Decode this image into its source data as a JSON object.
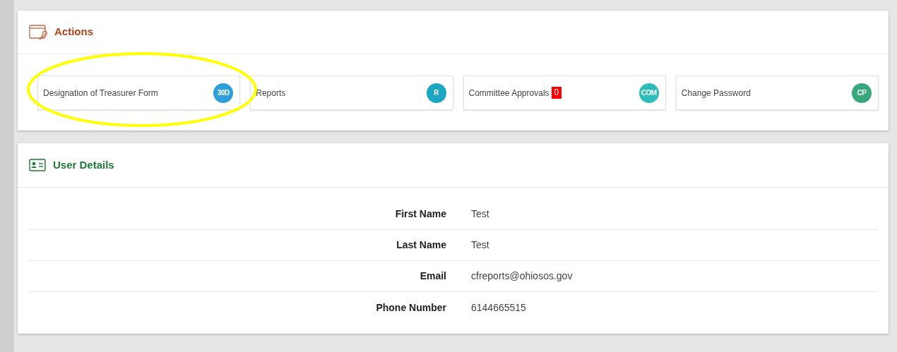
{
  "actions": {
    "title": "Actions",
    "tiles": [
      {
        "label": "Designation of Treasurer Form",
        "badge": "30D",
        "color": "#2f9fdc"
      },
      {
        "label": "Reports",
        "badge": "R",
        "color": "#1ba6c2"
      },
      {
        "label": "Committee Approvals",
        "count": "0",
        "badge": "COM",
        "color": "#2dbdb9"
      },
      {
        "label": "Change Password",
        "badge": "CP",
        "color": "#37a87c"
      }
    ]
  },
  "user_details": {
    "title": "User Details",
    "rows": [
      {
        "label": "First Name",
        "value": "Test"
      },
      {
        "label": "Last Name",
        "value": "Test"
      },
      {
        "label": "Email",
        "value": "cfreports@ohiosos.gov"
      },
      {
        "label": "Phone Number",
        "value": "6144665515"
      }
    ]
  },
  "highlight": {
    "kind": "ellipse"
  }
}
